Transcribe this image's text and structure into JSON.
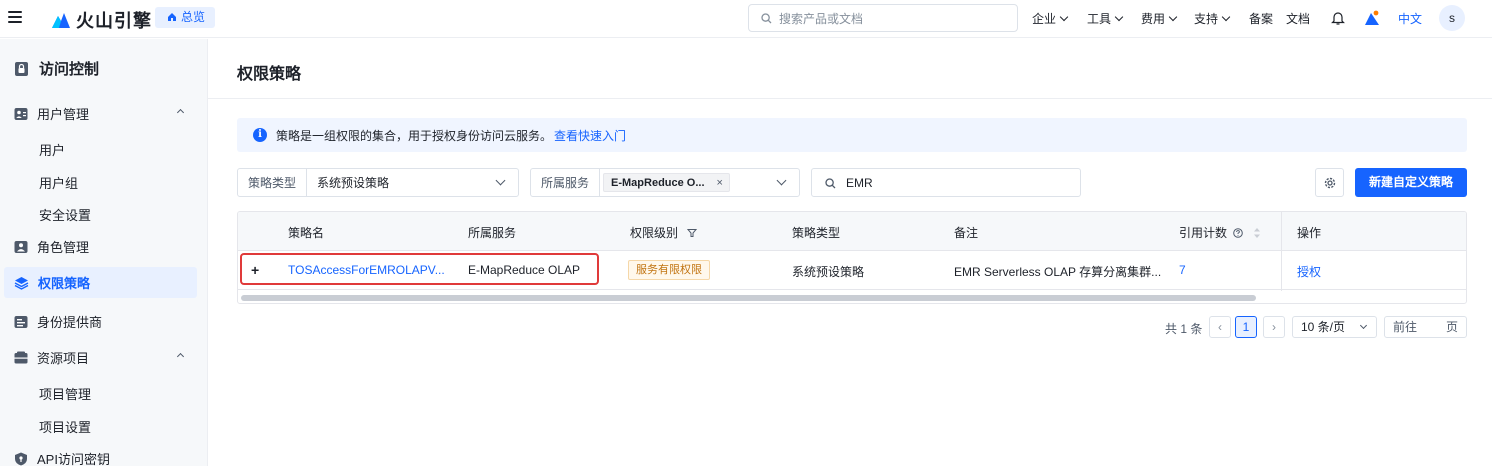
{
  "header": {
    "brand": "火山引擎",
    "overview_label": "总览",
    "search_placeholder": "搜索产品或文档",
    "nav": [
      "企业",
      "工具",
      "费用",
      "支持",
      "备案",
      "文档"
    ],
    "language": "中文",
    "avatar_initial": "s"
  },
  "sidebar": {
    "title": "访问控制",
    "items": [
      {
        "label": "用户管理",
        "icon": "user-manage-icon"
      },
      {
        "label": "用户"
      },
      {
        "label": "用户组"
      },
      {
        "label": "安全设置"
      },
      {
        "label": "角色管理",
        "icon": "role-icon"
      },
      {
        "label": "权限策略",
        "icon": "policy-layers-icon",
        "active": true
      },
      {
        "label": "身份提供商",
        "icon": "idp-icon"
      },
      {
        "label": "资源项目",
        "icon": "resource-icon"
      },
      {
        "label": "项目管理"
      },
      {
        "label": "项目设置"
      },
      {
        "label": "API访问密钥",
        "icon": "key-icon"
      }
    ]
  },
  "main": {
    "title": "权限策略",
    "info_text": "策略是一组权限的集合，用于授权身份访问云服务。",
    "info_link": "查看快速入门",
    "filters": {
      "policy_type_label": "策略类型",
      "policy_type_value": "系统预设策略",
      "service_label": "所属服务",
      "service_tag": "E-MapReduce O...",
      "search_value": "EMR"
    },
    "create_button": "新建自定义策略",
    "table": {
      "columns": [
        "策略名",
        "所属服务",
        "权限级别",
        "策略类型",
        "备注",
        "引用计数",
        "操作"
      ],
      "rows": [
        {
          "expand": "+",
          "name": "TOSAccessForEMROLAPV...",
          "service": "E-MapReduce OLAP",
          "level": "服务有限权限",
          "type": "系统预设策略",
          "remark": "EMR Serverless OLAP 存算分离集群...",
          "ref_count": "7",
          "action": "授权"
        }
      ]
    },
    "pagination": {
      "total": "共 1 条",
      "prev": "‹",
      "current": "1",
      "next": "›",
      "page_size": "10 条/页",
      "jump_prefix": "前往",
      "jump_suffix": "页"
    }
  },
  "colors": {
    "accent": "#1664ff",
    "highlight": "#e03a3a",
    "badge": "#c27411"
  }
}
